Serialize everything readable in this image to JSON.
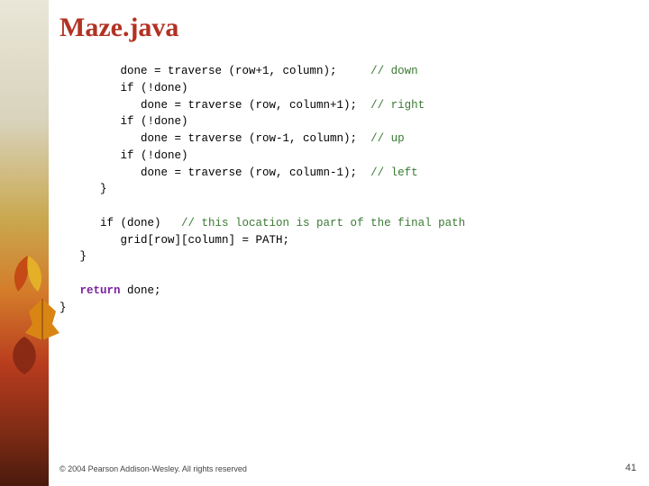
{
  "title": "Maze.java",
  "code": {
    "l1a": "         done = traverse (row+1, column);     ",
    "l1c": "// down",
    "l2": "         if (!done)",
    "l3a": "            done = traverse (row, column+1);  ",
    "l3c": "// right",
    "l4": "         if (!done)",
    "l5a": "            done = traverse (row-1, column);  ",
    "l5c": "// up",
    "l6": "         if (!done)",
    "l7a": "            done = traverse (row, column-1);  ",
    "l7c": "// left",
    "l8": "      }",
    "l9": "",
    "l10a": "      if (done)   ",
    "l10c": "// this location is part of the final path",
    "l11": "         grid[row][column] = PATH;",
    "l12": "   }",
    "l13": "",
    "l14a": "   ",
    "l14k": "return",
    "l14b": " done;",
    "l15": "}"
  },
  "copyright": "© 2004 Pearson Addison-Wesley. All rights reserved",
  "slide_number": "41"
}
